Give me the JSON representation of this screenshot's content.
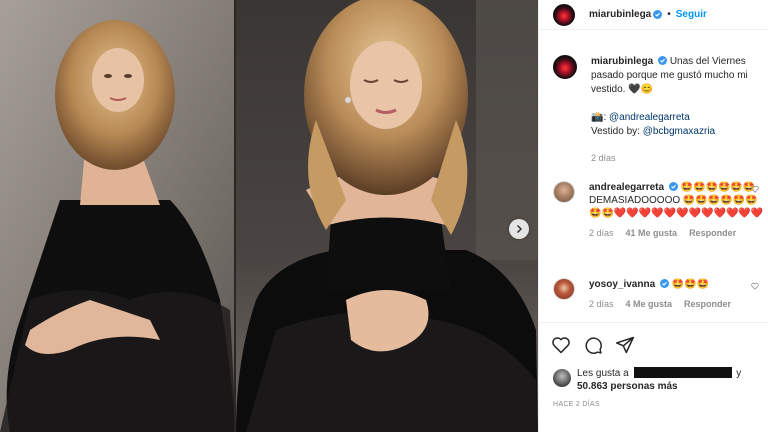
{
  "post": {
    "username": "miarubinlega",
    "follow_label": "Seguir",
    "separator": "•",
    "caption_lines": [
      "Unas del Viernes pasado porque me gustó mucho mi vestido. 🖤😊"
    ],
    "photo_credit_prefix": "📸: ",
    "photo_credit_mention": "@andrealegarreta",
    "dress_credit_prefix": "Vestido by: ",
    "dress_credit_mention": "@bcbgmaxazria",
    "caption_time": "2 días"
  },
  "comments": [
    {
      "username": "andrealegarreta",
      "text": "🤩🤩🤩🤩🤩🤩 DEMASIADOOOOO 🤩🤩🤩🤩🤩🤩🤩🤩❤️❤️❤️❤️❤️❤️❤️❤️❤️❤️❤️❤️",
      "time": "2 días",
      "likes": "41 Me gusta",
      "reply": "Responder"
    },
    {
      "username": "yosoy_ivanna",
      "text": "🤩🤩🤩",
      "time": "2 días",
      "likes": "4 Me gusta",
      "reply": "Responder"
    }
  ],
  "likes": {
    "prefix": "Les gusta a",
    "connector": "y",
    "count": "50.863 personas más"
  },
  "posted_ago": "HACE 2 DÍAS",
  "icons": {
    "verified": "verified-badge-icon",
    "like": "heart-icon",
    "comment": "comment-bubble-icon",
    "share": "paper-plane-icon",
    "next": "chevron-right-icon"
  },
  "colors": {
    "link_blue": "#0095f6",
    "verified_blue": "#3897f0",
    "mention": "#00376b",
    "muted": "#8e8e8e"
  }
}
